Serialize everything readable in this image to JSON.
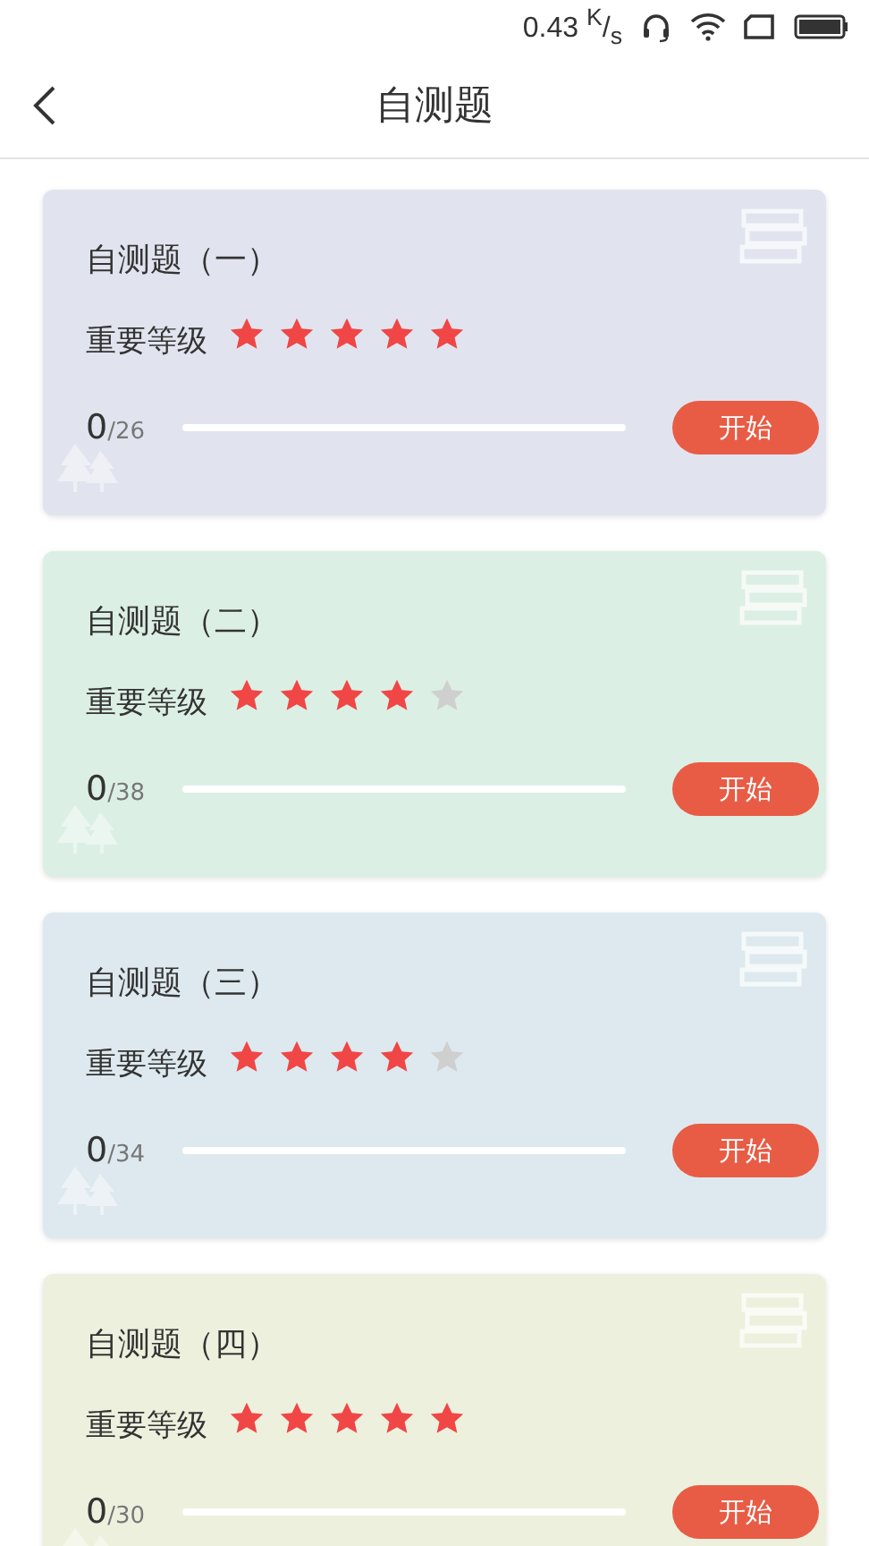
{
  "status_bar": {
    "speed": "0.43 $^{K}$/$_{s}$"
  },
  "header": {
    "title": "自测题"
  },
  "cards": [
    {
      "title": "自测题（一）",
      "level_label": "重要等级",
      "stars": 5,
      "done": "0",
      "total": "/26",
      "button": "开始",
      "color": "#e1e4ef"
    },
    {
      "title": "自测题（二）",
      "level_label": "重要等级",
      "stars": 4,
      "done": "0",
      "total": "/38",
      "button": "开始",
      "color": "#dcefe4"
    },
    {
      "title": "自测题（三）",
      "level_label": "重要等级",
      "stars": 4,
      "done": "0",
      "total": "/34",
      "button": "开始",
      "color": "#dde9ef"
    },
    {
      "title": "自测题（四）",
      "level_label": "重要等级",
      "stars": 5,
      "done": "0",
      "total": "/30",
      "button": "开始",
      "color": "#eef0de"
    }
  ]
}
